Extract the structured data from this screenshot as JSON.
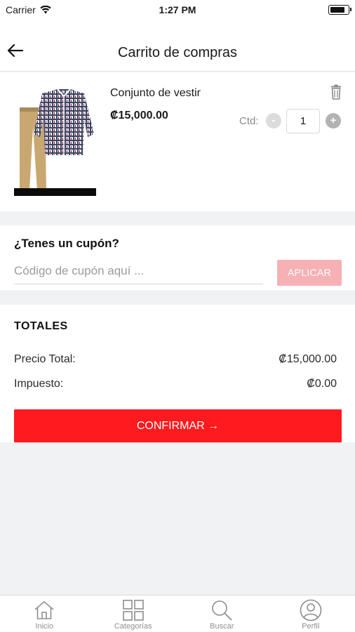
{
  "status_bar": {
    "carrier": "Carrier",
    "time": "1:27 PM",
    "battery_level": 0.82
  },
  "header": {
    "title": "Carrito de compras",
    "back_icon": "arrow-left-icon"
  },
  "cart": {
    "items": [
      {
        "name": "Conjunto de vestir",
        "price": "₡15,000.00",
        "image": "shirt-and-pants-product-image",
        "qty_label": "Ctd:",
        "quantity": "1",
        "minus_label": "-",
        "plus_label": "+"
      }
    ]
  },
  "coupon": {
    "title": "¿Tenes un cupón?",
    "placeholder": "Código de cupón aquí ...",
    "apply_label": "APLICAR"
  },
  "totals": {
    "title": "TOTALES",
    "rows": [
      {
        "label": "Precio Total:",
        "value": "₡15,000.00"
      },
      {
        "label": "Impuesto:",
        "value": "₡0.00"
      }
    ],
    "confirm_label": "CONFIRMAR →"
  },
  "tabs": [
    {
      "label": "Inicio",
      "icon": "home-icon"
    },
    {
      "label": "Categorías",
      "icon": "grid-icon"
    },
    {
      "label": "Buscar",
      "icon": "search-icon"
    },
    {
      "label": "Perfil",
      "icon": "user-icon"
    }
  ],
  "colors": {
    "accent": "#ff1a1f",
    "apply_disabled": "#f6b1b5",
    "background": "#f1f2f4"
  }
}
